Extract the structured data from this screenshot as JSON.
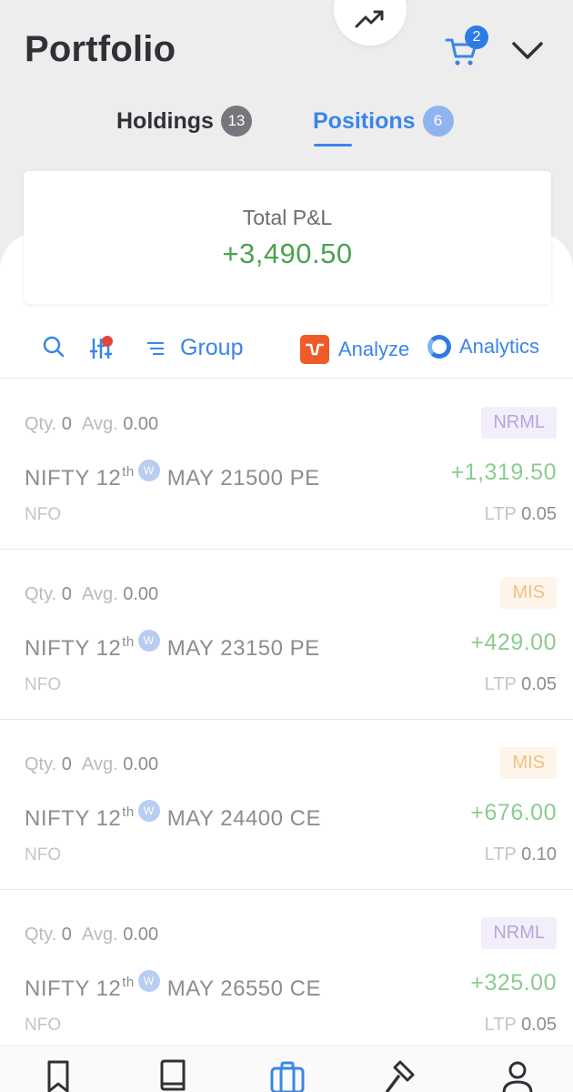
{
  "header": {
    "title": "Portfolio",
    "cart_count": "2"
  },
  "tabs": [
    {
      "label": "Holdings",
      "count": "13",
      "active": false
    },
    {
      "label": "Positions",
      "count": "6",
      "active": true
    }
  ],
  "summary": {
    "label": "Total P&L",
    "value": "+3,490.50"
  },
  "toolbar": {
    "group_label": "Group",
    "analyze_label": "Analyze",
    "analytics_label": "Analytics"
  },
  "positions": [
    {
      "qty_label": "Qty.",
      "qty": "0",
      "avg_label": "Avg.",
      "avg": "0.00",
      "product": "NRML",
      "symbol": "NIFTY 12",
      "suffix": "th",
      "weekly": "W",
      "expiry": "MAY 21500 PE",
      "pnl": "+1,319.50",
      "exchange": "NFO",
      "ltp_label": "LTP",
      "ltp": "0.05"
    },
    {
      "qty_label": "Qty.",
      "qty": "0",
      "avg_label": "Avg.",
      "avg": "0.00",
      "product": "MIS",
      "symbol": "NIFTY 12",
      "suffix": "th",
      "weekly": "W",
      "expiry": "MAY 23150 PE",
      "pnl": "+429.00",
      "exchange": "NFO",
      "ltp_label": "LTP",
      "ltp": "0.05"
    },
    {
      "qty_label": "Qty.",
      "qty": "0",
      "avg_label": "Avg.",
      "avg": "0.00",
      "product": "MIS",
      "symbol": "NIFTY 12",
      "suffix": "th",
      "weekly": "W",
      "expiry": "MAY 24400 CE",
      "pnl": "+676.00",
      "exchange": "NFO",
      "ltp_label": "LTP",
      "ltp": "0.10"
    },
    {
      "qty_label": "Qty.",
      "qty": "0",
      "avg_label": "Avg.",
      "avg": "0.00",
      "product": "NRML",
      "symbol": "NIFTY 12",
      "suffix": "th",
      "weekly": "W",
      "expiry": "MAY 26550 CE",
      "pnl": "+325.00",
      "exchange": "NFO",
      "ltp_label": "LTP",
      "ltp": "0.05"
    }
  ],
  "bottom_nav": [
    {
      "icon": "bookmark-icon",
      "active": false
    },
    {
      "icon": "book-icon",
      "active": false
    },
    {
      "icon": "briefcase-icon",
      "active": true
    },
    {
      "icon": "gavel-icon",
      "active": false
    },
    {
      "icon": "user-icon",
      "active": false
    }
  ],
  "colors": {
    "accent": "#3a86e8",
    "profit": "#4aa34f",
    "analyze": "#f05a28",
    "alert_dot": "#e2453a"
  }
}
